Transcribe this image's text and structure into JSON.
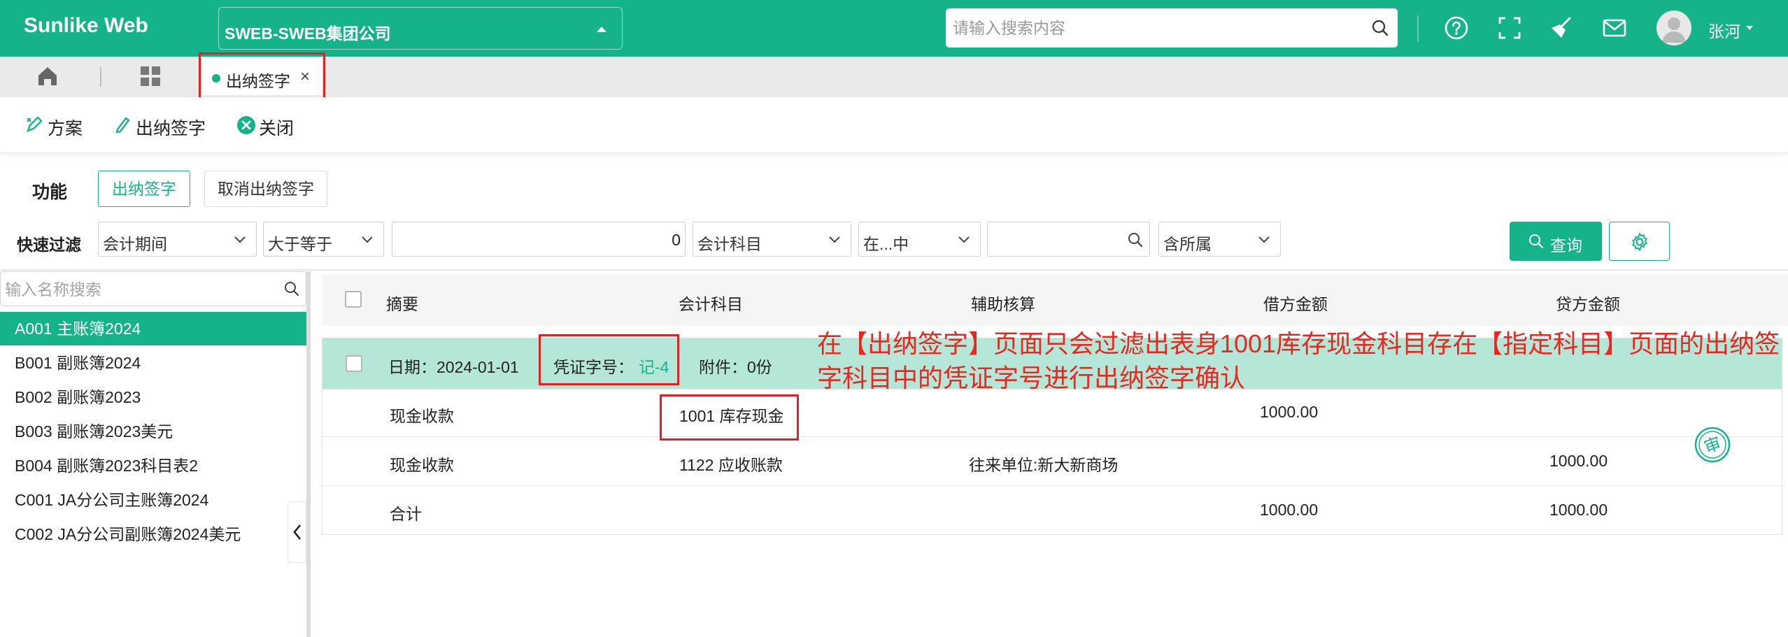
{
  "app": {
    "brand": "Sunlike Web",
    "company": "SWEB-SWEB集团公司"
  },
  "header": {
    "search_placeholder": "请输入搜索内容",
    "user": "张河"
  },
  "tabs": {
    "active_label": "出纳签字"
  },
  "toolbar": {
    "scheme": "方案",
    "cashier_sign": "出纳签字",
    "close": "关闭"
  },
  "function": {
    "label": "功能",
    "sign": "出纳签字",
    "unsign": "取消出纳签字"
  },
  "quick_filter": {
    "label": "快速过滤",
    "field1": "会计期间",
    "op1": "大于等于",
    "value1": "0",
    "field2": "会计科目",
    "op2": "在...中",
    "value2": "",
    "option": "含所属",
    "query": "查询"
  },
  "left_panel": {
    "search_placeholder": "输入名称搜索",
    "books": [
      "A001 主账簿2024",
      "B001 副账簿2024",
      "B002 副账簿2023",
      "B003 副账簿2023美元",
      "B004 副账簿2023科目表2",
      "C001 JA分公司主账簿2024",
      "C002 JA分公司副账簿2024美元"
    ],
    "selected_index": 0
  },
  "grid": {
    "columns": {
      "summary": "摘要",
      "account": "会计科目",
      "aux": "辅助核算",
      "debit": "借方金额",
      "credit": "贷方金额"
    },
    "voucher": {
      "date": "日期：2024-01-01",
      "no_label": "凭证字号：",
      "no_value": "记-4",
      "attach": "附件：0份"
    },
    "rows": [
      {
        "summary": "现金收款",
        "account": "1001 库存现金",
        "aux": "",
        "debit": "1000.00",
        "credit": ""
      },
      {
        "summary": "现金收款",
        "account": "1122 应收账款",
        "aux": "往来单位:新大新商场",
        "debit": "",
        "credit": "1000.00"
      }
    ],
    "total": {
      "summary": "合计",
      "debit": "1000.00",
      "credit": "1000.00"
    }
  },
  "annotation": "在【出纳签字】页面只会过滤出表身1001库存现金科目存在【指定科目】页面的出纳签字科目中的凭证字号进行出纳签字确认",
  "colors": {
    "primary": "#15b38a",
    "selected_row": "#b5e7d8",
    "highlight": "#e02222"
  }
}
